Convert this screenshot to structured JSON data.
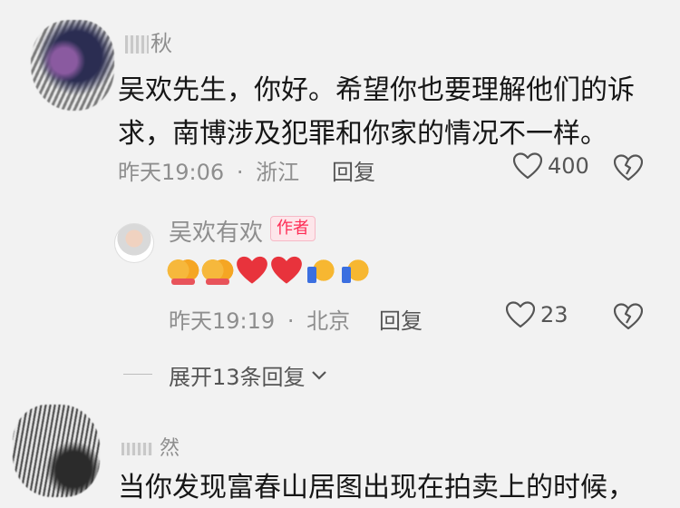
{
  "comments": [
    {
      "username": "秋",
      "text_line1": "吴欢先生，你好。希望你也要理解他们的诉",
      "text_line2": "求，南博涉及犯罪和你家的情况不一样。",
      "time": "昨天19:06",
      "location": "浙江",
      "reply_label": "回复",
      "likes": "400",
      "replies": [
        {
          "username": "吴欢有欢",
          "badge": "作者",
          "emojis": [
            "folded-hands",
            "folded-hands",
            "red-heart",
            "red-heart",
            "thumbs-up",
            "thumbs-up"
          ],
          "time": "昨天19:19",
          "location": "北京",
          "reply_label": "回复",
          "likes": "23"
        }
      ],
      "expand_label": "展开13条回复"
    },
    {
      "username": "然",
      "text": "当你发现富春山居图出现在拍卖上的时候，"
    }
  ],
  "separator": "·",
  "icons": {
    "like": "heart-outline-icon",
    "dislike": "broken-heart-icon",
    "expand": "chevron-down-icon"
  },
  "colors": {
    "author_badge": "#fe2c55",
    "heart_emoji": "#e8333c"
  }
}
